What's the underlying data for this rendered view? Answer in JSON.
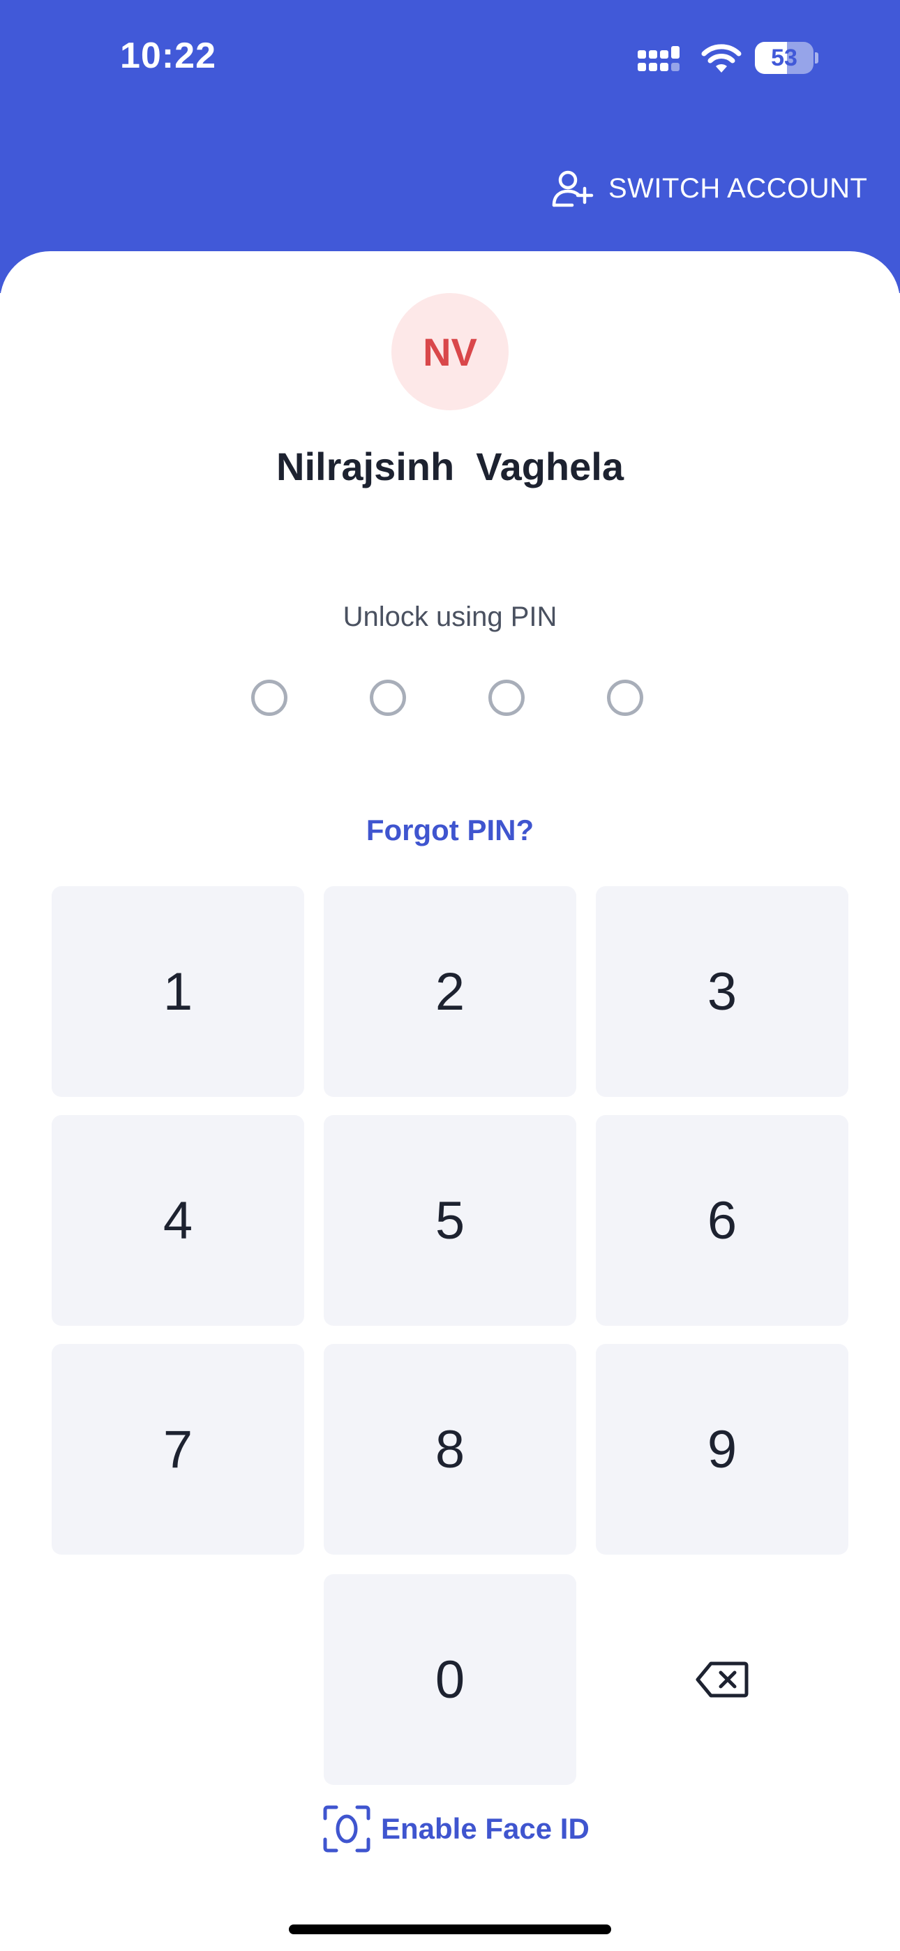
{
  "status_bar": {
    "time": "10:22",
    "battery": "53"
  },
  "header": {
    "switch_account_label": "SWITCH ACCOUNT",
    "switch_account_icon": "add-user-icon"
  },
  "profile": {
    "initials": "NV",
    "name": "Nilrajsinh  Vaghela"
  },
  "pin": {
    "label": "Unlock using PIN",
    "length": 4,
    "entered": 0,
    "forgot_label": "Forgot PIN?"
  },
  "keypad": {
    "keys": [
      "1",
      "2",
      "3",
      "4",
      "5",
      "6",
      "7",
      "8",
      "9",
      "0"
    ],
    "backspace_icon": "backspace-icon"
  },
  "face_id": {
    "label": "Enable Face ID",
    "icon": "face-id-icon"
  },
  "colors": {
    "primary": "#4159d8",
    "link": "#3f55cf",
    "avatar_bg": "#fde8e8",
    "avatar_text": "#d9474a",
    "key_bg": "#f3f4f9",
    "text": "#1d2230"
  }
}
